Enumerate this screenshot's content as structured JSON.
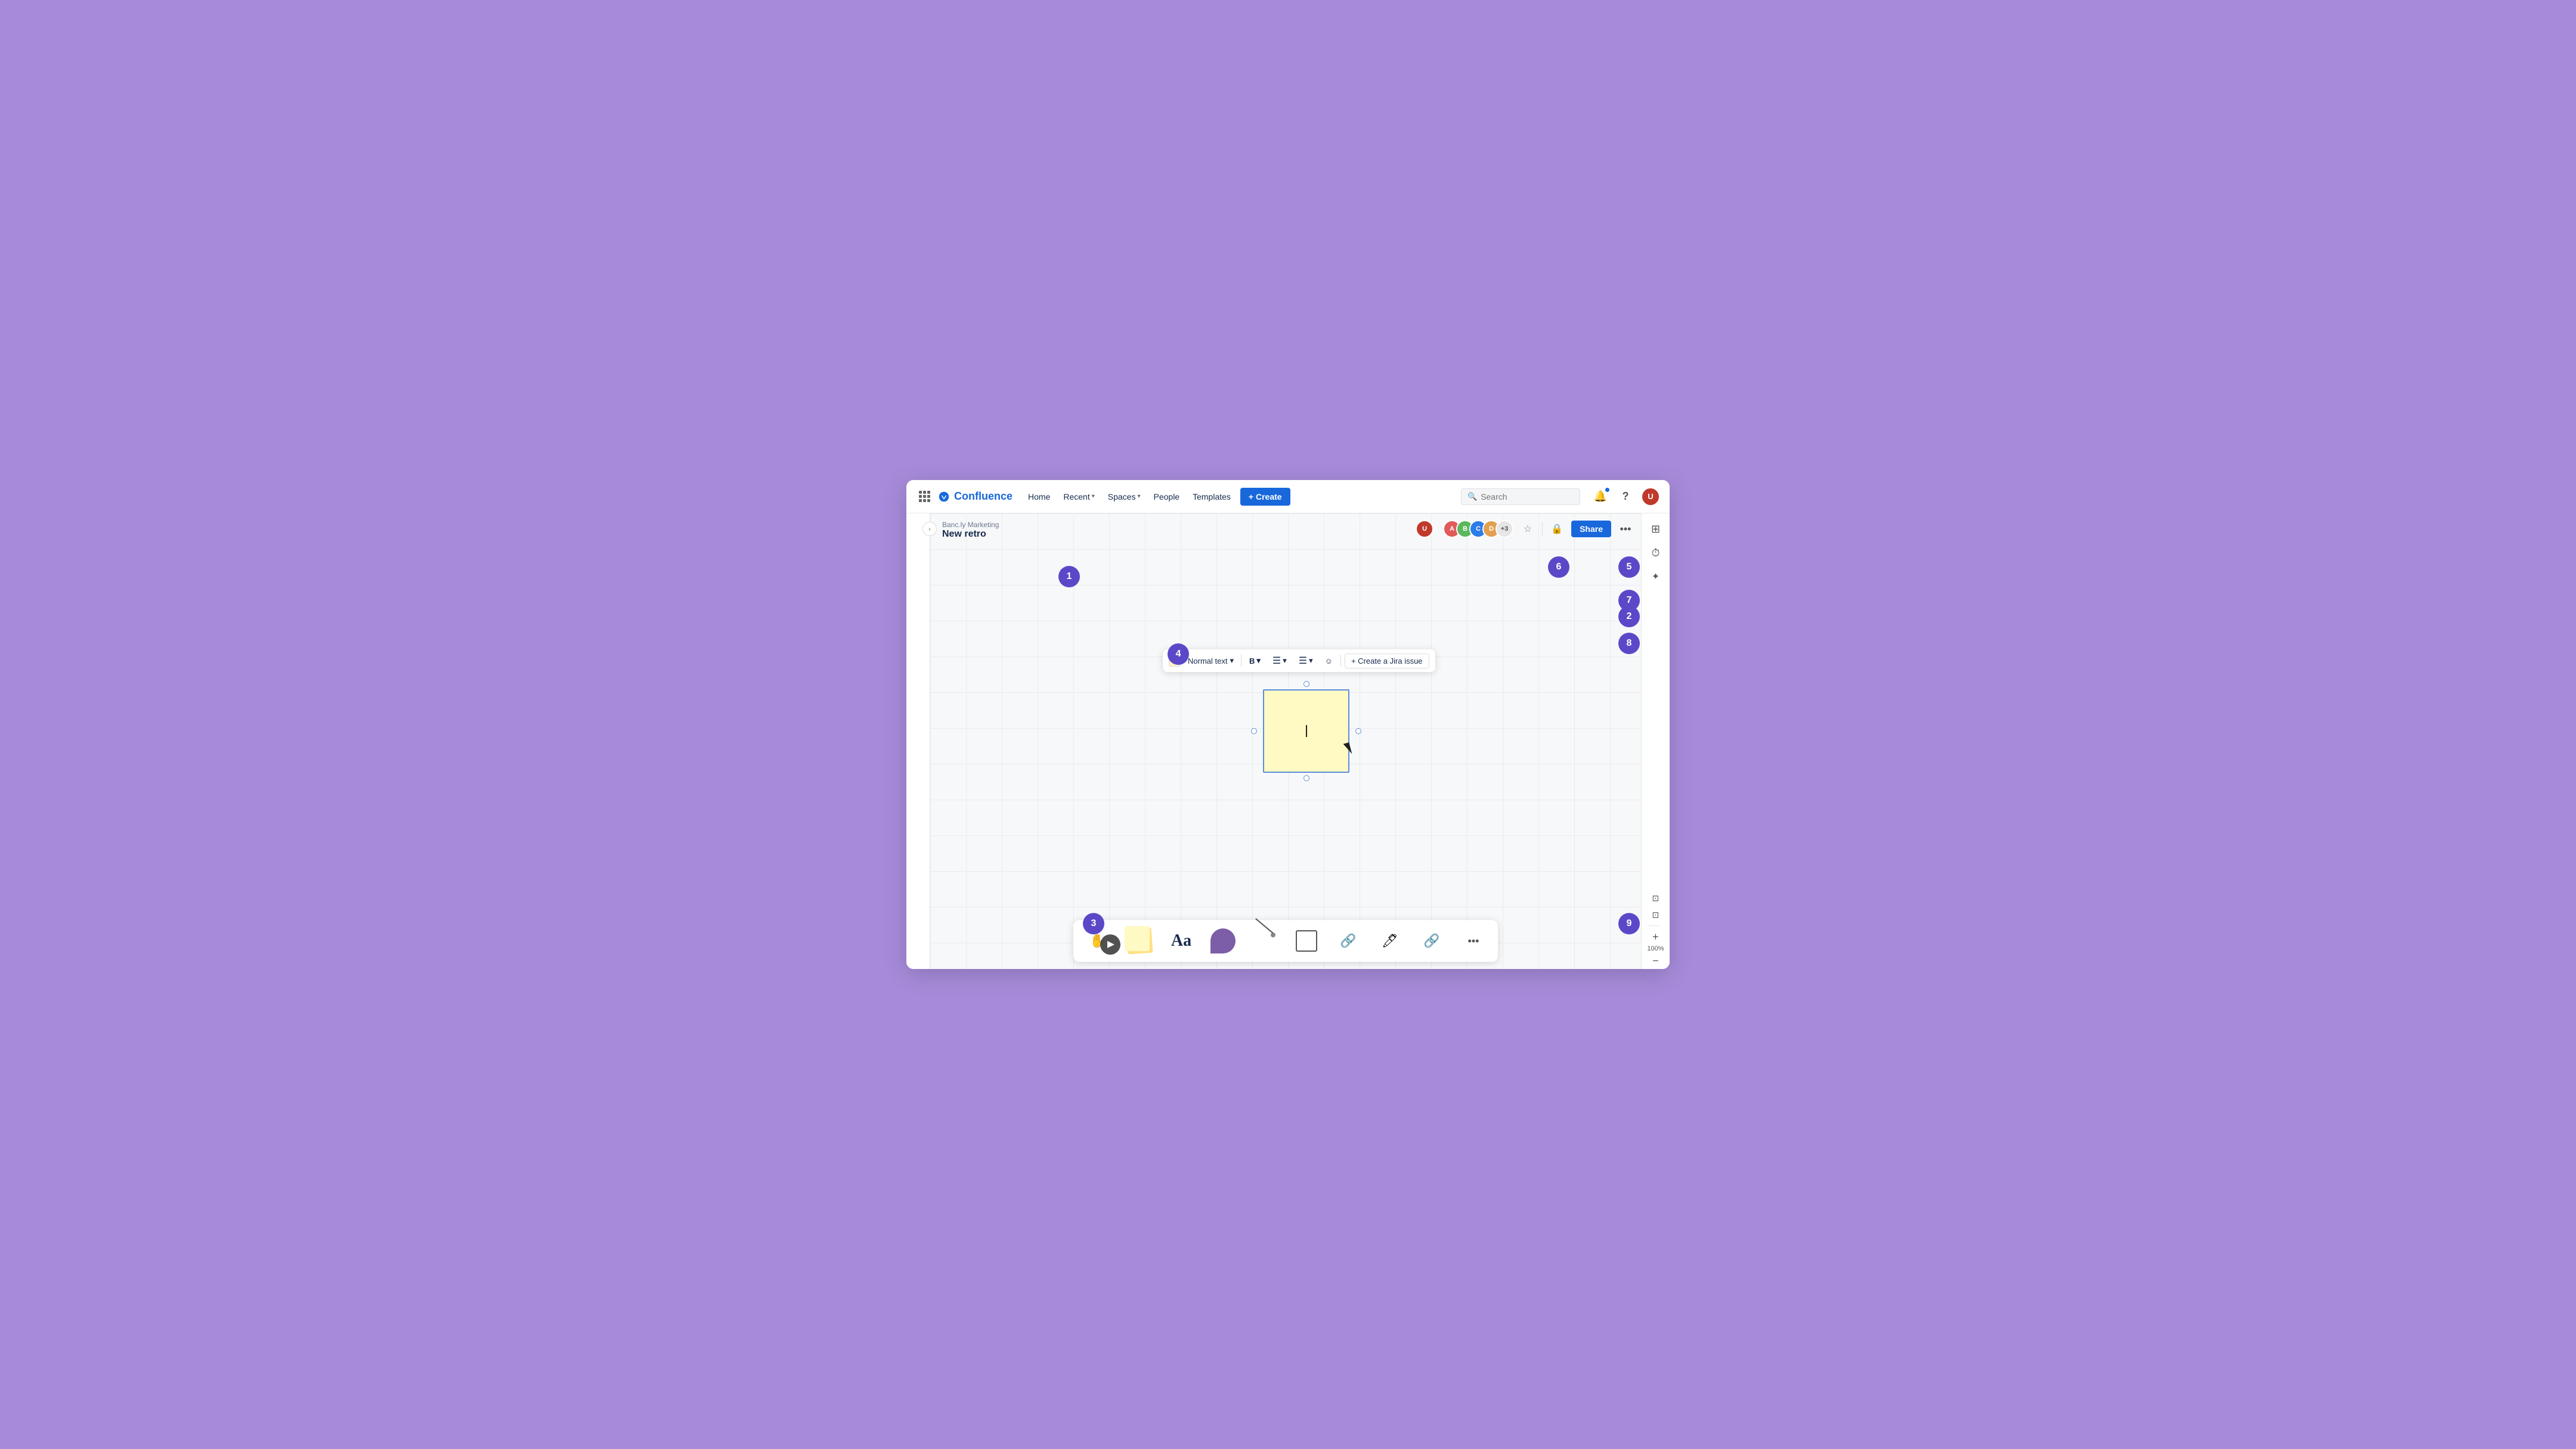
{
  "app": {
    "name": "Confluence",
    "logo_text": "Confluence"
  },
  "navbar": {
    "home": "Home",
    "recent": "Recent",
    "spaces": "Spaces",
    "people": "People",
    "templates": "Templates",
    "create_label": "+ Create",
    "search_placeholder": "Search"
  },
  "breadcrumb": {
    "parent": "Banc.ly Marketing",
    "title": "New retro"
  },
  "toolbar": {
    "color_swatch": "yellow",
    "text_style": "Normal text",
    "bold": "B",
    "list": "≡",
    "align": "≡",
    "emoji": "☺",
    "jira": "+ Create a Jira issue"
  },
  "sticky": {
    "background": "#fff9c4"
  },
  "share_btn": "Share",
  "zoom": {
    "level": "100%",
    "plus": "+",
    "minus": "−"
  },
  "circle_labels": {
    "one": "1",
    "two": "2",
    "three": "3",
    "four": "4",
    "five": "5",
    "six": "6",
    "seven": "7",
    "eight": "8",
    "nine": "9"
  },
  "bottom_toolbar": {
    "sticky_label": "",
    "text_label": "",
    "shape_label": "",
    "line_label": "",
    "frame_label": "",
    "link_label": "",
    "stamp_label": "",
    "more_label": "..."
  },
  "avatar_count": "+3",
  "avatars": [
    {
      "color": "#e05c5c",
      "initials": "A"
    },
    {
      "color": "#5cb85c",
      "initials": "B"
    },
    {
      "color": "#2b7de9",
      "initials": "C"
    },
    {
      "color": "#e0a050",
      "initials": "D"
    }
  ],
  "right_panel": {
    "table_icon": "⊞",
    "clock_icon": "⏱",
    "star_icon": "✦"
  }
}
